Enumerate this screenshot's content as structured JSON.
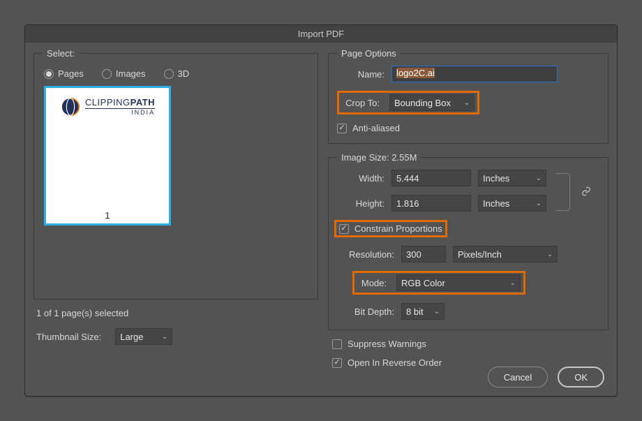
{
  "dialog": {
    "title": "Import PDF"
  },
  "left": {
    "legend": "Select:",
    "radios": {
      "pages": "Pages",
      "images": "Images",
      "three_d": "3D",
      "selected": "pages"
    },
    "thumb": {
      "num": "1",
      "logo_main": "CLIPPING",
      "logo_bold": "PATH",
      "logo_sub": "INDIA"
    },
    "status": "1 of 1 page(s) selected",
    "thumbsize_label": "Thumbnail Size:",
    "thumbsize_value": "Large"
  },
  "page_options": {
    "legend": "Page Options",
    "name_label": "Name:",
    "name_value": "logo2C.ai",
    "crop_label": "Crop To:",
    "crop_value": "Bounding Box",
    "aa_label": "Anti-aliased",
    "aa_checked": true
  },
  "image_size": {
    "legend_prefix": "Image Size:",
    "size_text": "2.55M",
    "width_label": "Width:",
    "width_value": "5.444",
    "width_unit": "Inches",
    "height_label": "Height:",
    "height_value": "1.816",
    "height_unit": "Inches",
    "constrain_label": "Constrain Proportions",
    "constrain_checked": true,
    "resolution_label": "Resolution:",
    "resolution_value": "300",
    "resolution_unit": "Pixels/Inch",
    "mode_label": "Mode:",
    "mode_value": "RGB Color",
    "bitdepth_label": "Bit Depth:",
    "bitdepth_value": "8 bit"
  },
  "bottom": {
    "suppress_label": "Suppress Warnings",
    "suppress_checked": false,
    "reverse_label": "Open In Reverse Order",
    "reverse_checked": true
  },
  "buttons": {
    "cancel": "Cancel",
    "ok": "OK"
  }
}
